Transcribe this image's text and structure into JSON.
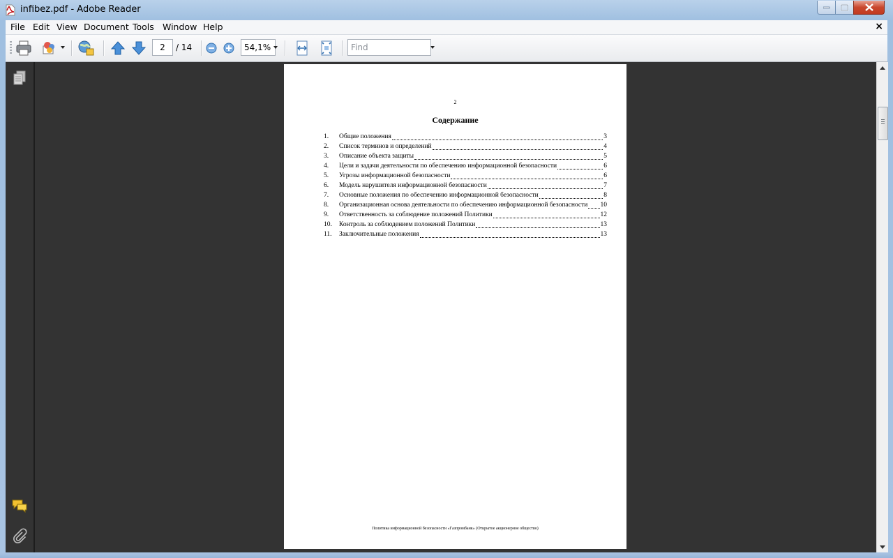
{
  "window": {
    "title": "infibez.pdf - Adobe Reader"
  },
  "menubar": {
    "items": [
      "File",
      "Edit",
      "View",
      "Document",
      "Tools",
      "Window",
      "Help"
    ],
    "close_doc": "×"
  },
  "toolbar": {
    "current_page": "2",
    "total_pages": "/ 14",
    "zoom": "54,1%",
    "find_placeholder": "Find",
    "icons": [
      "printer-icon",
      "share-icon",
      "collaborate-icon",
      "previous-page-icon",
      "next-page-icon",
      "zoom-out-icon",
      "zoom-in-icon",
      "fit-width-icon",
      "fit-page-icon"
    ]
  },
  "navpane": {
    "icons": [
      "pages-icon",
      "comments-icon",
      "attachments-icon"
    ]
  },
  "document": {
    "page_number": "2",
    "toc_title": "Содержание",
    "toc": [
      {
        "num": "1.",
        "text": "Общие положения",
        "page": "3"
      },
      {
        "num": "2.",
        "text": "Список терминов и определений",
        "page": "4"
      },
      {
        "num": "3.",
        "text": "Описание объекта защиты",
        "page": "5"
      },
      {
        "num": "4.",
        "text": "Цели и задачи деятельности по обеспечению информационной безопасности",
        "page": "6"
      },
      {
        "num": "5.",
        "text": "Угрозы информационной безопасности",
        "page": "6"
      },
      {
        "num": "6.",
        "text": "Модель нарушителя информационной безопасности",
        "page": "7"
      },
      {
        "num": "7.",
        "text": "Основные положения по обеспечению информационной безопасности",
        "page": "8"
      },
      {
        "num": "8.",
        "text": "Организационная основа деятельности по обеспечению  информационной безопасности",
        "page": "10"
      },
      {
        "num": "9.",
        "text": "Ответственность за соблюдение положений Политики",
        "page": "12"
      },
      {
        "num": "10.",
        "text": "Контроль за соблюдением положений Политики",
        "page": "13"
      },
      {
        "num": "11.",
        "text": "Заключительные положения",
        "page": "13"
      }
    ],
    "footer": "Политика информационной безопасности «Газпромбанк» (Открытое акционерное общество)"
  }
}
